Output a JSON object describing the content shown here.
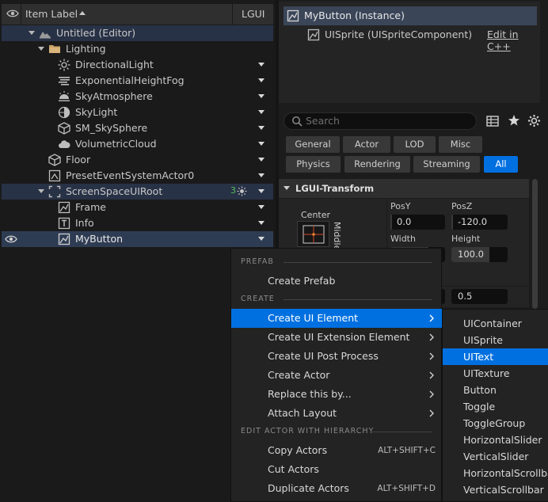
{
  "outliner": {
    "header": {
      "item_label": "Item Label",
      "type_col": "LGUI"
    },
    "rows": [
      {
        "label": "Untitled (Editor)"
      },
      {
        "label": "Lighting"
      },
      {
        "label": "DirectionalLight"
      },
      {
        "label": "ExponentialHeightFog"
      },
      {
        "label": "SkyAtmosphere"
      },
      {
        "label": "SkyLight"
      },
      {
        "label": "SM_SkySphere"
      },
      {
        "label": "VolumetricCloud"
      },
      {
        "label": "Floor"
      },
      {
        "label": "PresetEventSystemActor0"
      },
      {
        "label": "ScreenSpaceUIRoot",
        "badge": "3"
      },
      {
        "label": "Frame"
      },
      {
        "label": "Info"
      },
      {
        "label": "MyButton"
      }
    ]
  },
  "details": {
    "components": {
      "root": "MyButton (Instance)",
      "child": "UISprite (UISpriteComponent)",
      "edit_link": "Edit in C++"
    },
    "search": {
      "placeholder": "Search"
    },
    "filters": {
      "row1": [
        "General",
        "Actor",
        "LOD",
        "Misc"
      ],
      "row2": [
        "Physics",
        "Rendering",
        "Streaming",
        "All"
      ],
      "active": "All"
    },
    "transform": {
      "section": "LGUI-Transform",
      "anchor_h": "Center",
      "anchor_v": "Middle",
      "pos_y_label": "PosY",
      "pos_z_label": "PosZ",
      "pos_y": "0.0",
      "pos_z": "-120.0",
      "width_label": "Width",
      "height_label": "Height",
      "height": "100.0",
      "pivot_y": "0.5"
    }
  },
  "context_menu": {
    "sections": {
      "prefab": "PREFAB",
      "create": "CREATE",
      "hierarchy": "EDIT ACTOR WITH HIERARCHY"
    },
    "items": {
      "create_prefab": "Create Prefab",
      "create_ui_element": "Create UI Element",
      "create_ui_extension": "Create UI Extension Element",
      "create_ui_post": "Create UI Post Process",
      "create_actor": "Create Actor",
      "replace_this": "Replace this by...",
      "attach_layout": "Attach Layout",
      "copy_actors": "Copy Actors",
      "copy_shortcut": "ALT+SHIFT+C",
      "cut_actors": "Cut Actors",
      "duplicate_actors": "Duplicate Actors",
      "duplicate_shortcut": "ALT+SHIFT+D"
    },
    "submenu": [
      "UIContainer",
      "UISprite",
      "UIText",
      "UITexture",
      "Button",
      "Toggle",
      "ToggleGroup",
      "HorizontalSlider",
      "VerticalSlider",
      "HorizontalScrollbar",
      "VerticalScrollbar"
    ],
    "submenu_selected": "UIText"
  },
  "colors": {
    "accent": "#0070e0",
    "selection_row": "#2e3c53",
    "panel": "#1a1a1a"
  }
}
